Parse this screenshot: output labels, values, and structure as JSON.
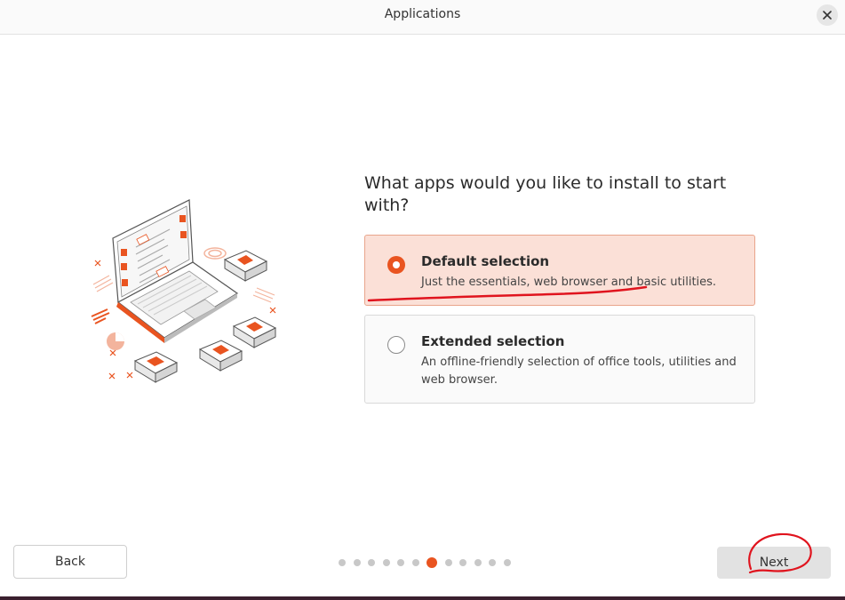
{
  "window": {
    "title": "Applications",
    "close_icon": "close-icon"
  },
  "main": {
    "question": "What apps would you like to install to start with?",
    "options": [
      {
        "title": "Default selection",
        "description": "Just the essentials, web browser and basic utilities.",
        "selected": true
      },
      {
        "title": "Extended selection",
        "description": "An offline-friendly selection of office tools, utilities and web browser.",
        "selected": false
      }
    ]
  },
  "footer": {
    "back_label": "Back",
    "next_label": "Next",
    "progress": {
      "total": 12,
      "current": 7
    }
  },
  "colors": {
    "accent": "#e95420",
    "selected_bg": "#fbe0d7",
    "annotation": "#e0141e"
  }
}
